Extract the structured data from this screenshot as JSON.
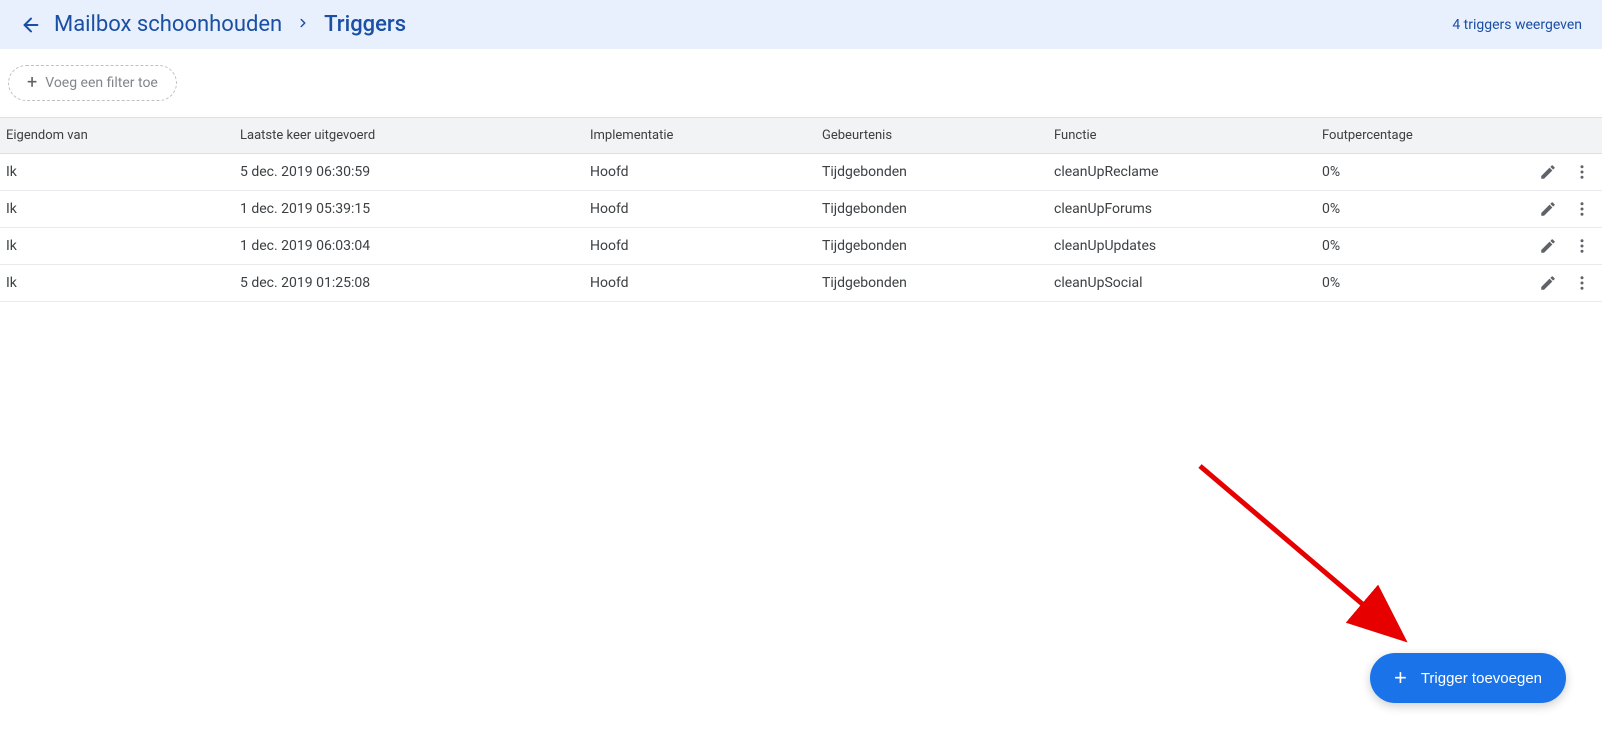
{
  "header": {
    "breadcrumb_parent": "Mailbox schoonhouden",
    "breadcrumb_current": "Triggers",
    "summary": "4 triggers weergeven"
  },
  "filter": {
    "add_filter_label": "Voeg een filter toe"
  },
  "table": {
    "headers": {
      "owner": "Eigendom van",
      "last_run": "Laatste keer uitgevoerd",
      "implementation": "Implementatie",
      "event": "Gebeurtenis",
      "function": "Functie",
      "error_rate": "Foutpercentage"
    },
    "rows": [
      {
        "owner": "Ik",
        "last_run": "5 dec. 2019 06:30:59",
        "implementation": "Hoofd",
        "event": "Tijdgebonden",
        "function": "cleanUpReclame",
        "error_rate": "0%"
      },
      {
        "owner": "Ik",
        "last_run": "1 dec. 2019 05:39:15",
        "implementation": "Hoofd",
        "event": "Tijdgebonden",
        "function": "cleanUpForums",
        "error_rate": "0%"
      },
      {
        "owner": "Ik",
        "last_run": "1 dec. 2019 06:03:04",
        "implementation": "Hoofd",
        "event": "Tijdgebonden",
        "function": "cleanUpUpdates",
        "error_rate": "0%"
      },
      {
        "owner": "Ik",
        "last_run": "5 dec. 2019 01:25:08",
        "implementation": "Hoofd",
        "event": "Tijdgebonden",
        "function": "cleanUpSocial",
        "error_rate": "0%"
      }
    ]
  },
  "fab": {
    "label": "Trigger toevoegen"
  }
}
